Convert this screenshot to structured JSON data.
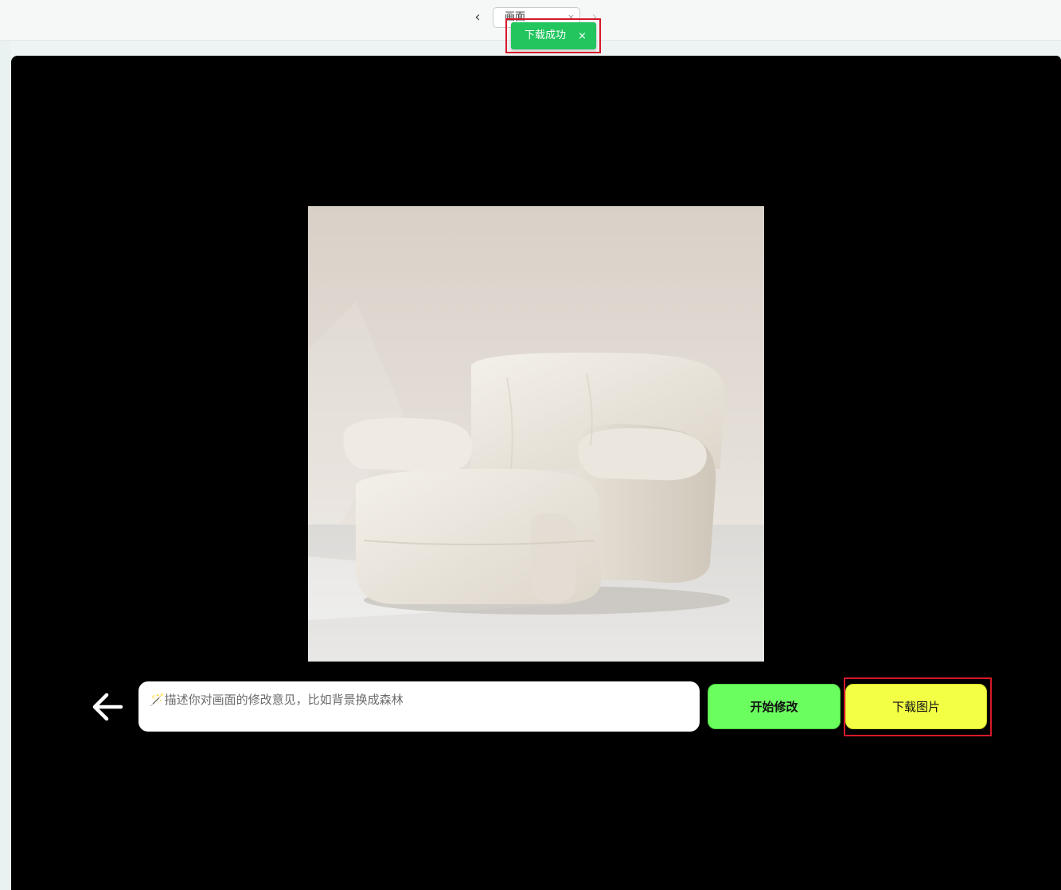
{
  "header": {
    "tab_label": "画面...",
    "back_glyph": "‹",
    "forward_glyph": "›",
    "tab_close_glyph": "×"
  },
  "toast": {
    "message": "下载成功",
    "close_glyph": "×",
    "color": "#22c55e"
  },
  "editor": {
    "prompt_placeholder": "🪄描述你对画面的修改意见，比如背景换成森林",
    "prompt_value": "",
    "start_edit_label": "开始修改",
    "download_label": "下载图片",
    "start_edit_color": "#6aff5f",
    "download_color": "#f2ff44"
  },
  "image": {
    "subject": "cream boucle armchair"
  },
  "icons": {
    "back": "arrow-left-icon",
    "wand": "magic-wand-icon"
  }
}
